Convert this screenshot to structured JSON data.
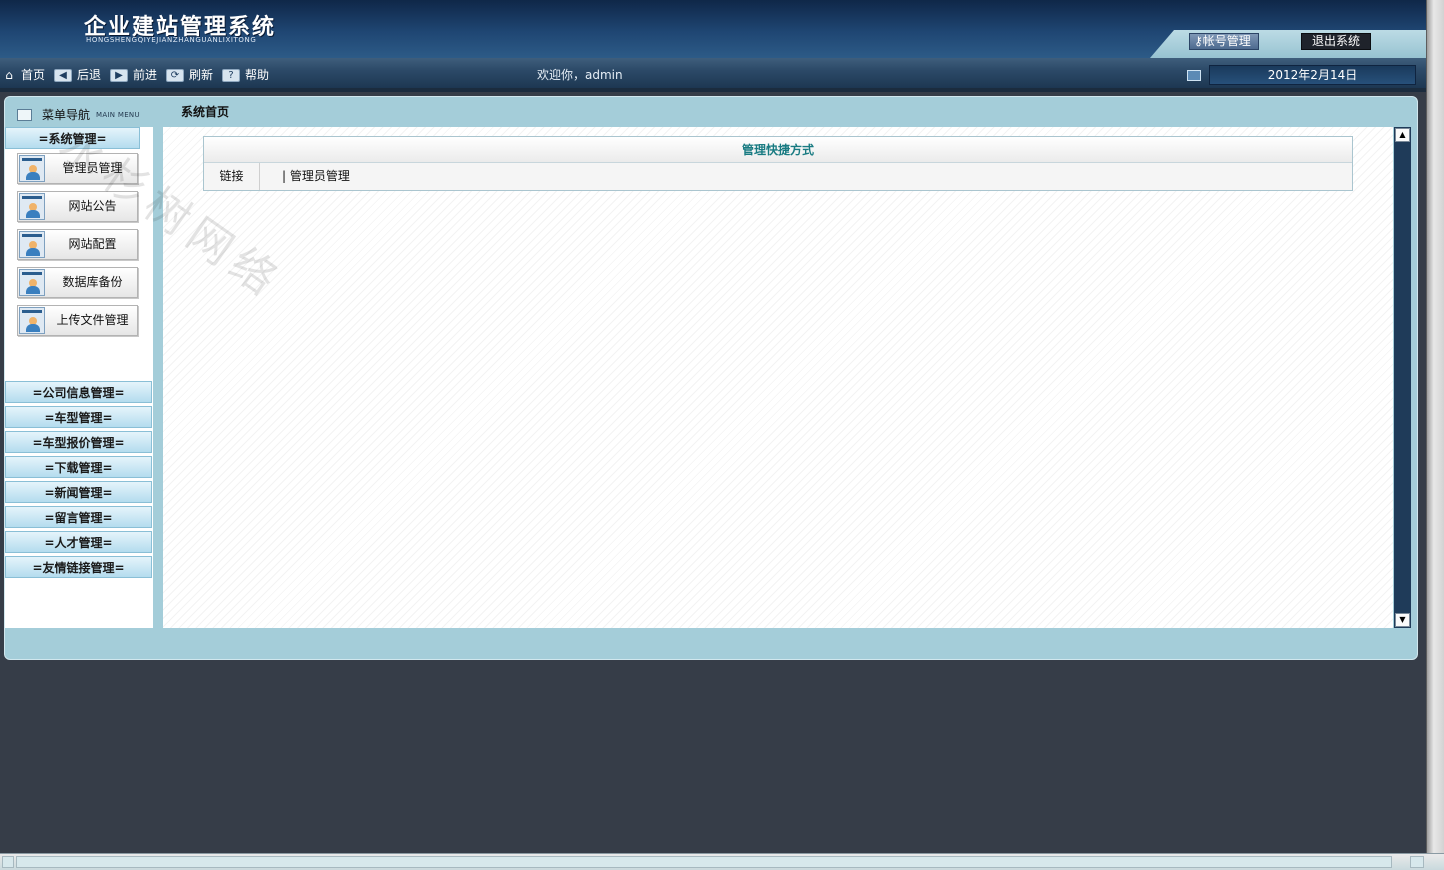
{
  "header": {
    "title": "企业建站管理系统",
    "subtitle": "HONGSHENGQIYEJIANZHANGUANLIXITONG",
    "account_button": "帐号管理",
    "logout_button": "退出系统"
  },
  "toolbar": {
    "home": "首页",
    "back": "后退",
    "forward": "前进",
    "refresh": "刷新",
    "help": "帮助",
    "welcome": "欢迎你，admin",
    "date": "2012年2月14日"
  },
  "sidebar": {
    "title": "菜单导航",
    "title_en": "MAIN MENU",
    "active_group": "=系统管理=",
    "items": [
      {
        "label": "管理员管理"
      },
      {
        "label": "网站公告"
      },
      {
        "label": "网站配置"
      },
      {
        "label": "数据库备份"
      },
      {
        "label": "上传文件管理"
      }
    ],
    "groups": [
      {
        "label": "=公司信息管理="
      },
      {
        "label": "=车型管理="
      },
      {
        "label": "=车型报价管理="
      },
      {
        "label": "=下载管理="
      },
      {
        "label": "=新闻管理="
      },
      {
        "label": "=留言管理="
      },
      {
        "label": "=人才管理="
      },
      {
        "label": "=友情链接管理="
      }
    ]
  },
  "main": {
    "breadcrumb": "系统首页",
    "panel_title": "管理快捷方式",
    "row_label": "链接",
    "row_link": "| 管理员管理"
  },
  "watermark": "水杉树网络",
  "icons": {
    "home": "home-icon",
    "back": "arrow-left-icon",
    "forward": "arrow-right-icon",
    "refresh": "refresh-icon",
    "help": "help-icon",
    "monitor": "monitor-icon",
    "key": "key-icon"
  }
}
